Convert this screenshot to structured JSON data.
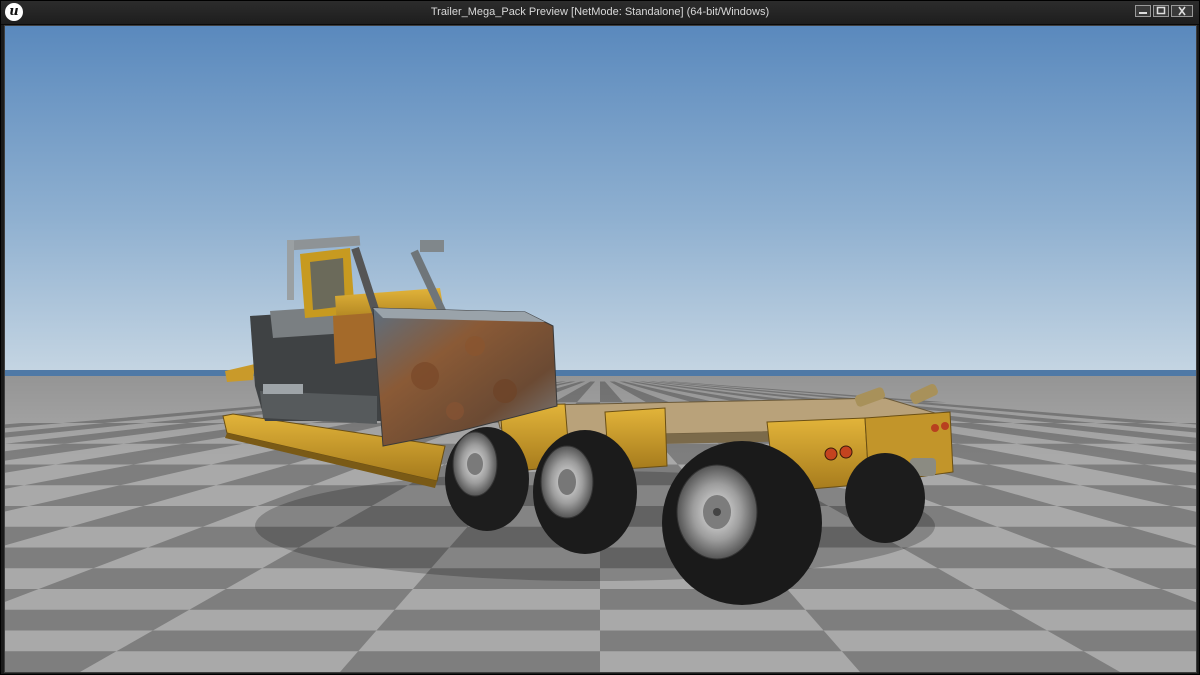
{
  "window": {
    "title": "Trailer_Mega_Pack Preview [NetMode: Standalone]  (64-bit/Windows)",
    "logo_icon": "unreal-engine-logo",
    "controls": [
      "minimize",
      "maximize",
      "close"
    ]
  },
  "colors": {
    "sky_top": "#5f8ec0",
    "sky_horizon": "#bfd1e1",
    "ground_light": "#a9a9a9",
    "ground_dark": "#7e7e7e",
    "trailer_yellow": "#d8a420",
    "tire_black": "#1a1a1a"
  }
}
